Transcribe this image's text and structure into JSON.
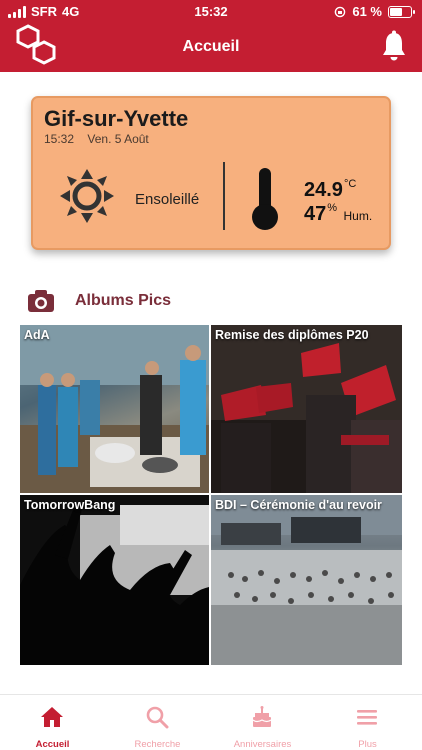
{
  "status_bar": {
    "carrier": "SFR",
    "network": "4G",
    "time": "15:32",
    "battery": "61 %",
    "battery_level": 0.61
  },
  "nav": {
    "title": "Accueil"
  },
  "weather": {
    "city": "Gif-sur-Yvette",
    "time": "15:32",
    "date": "Ven. 5 Août",
    "condition": "Ensoleillé",
    "temperature": "24.9",
    "temperature_unit": "°C",
    "humidity": "47",
    "humidity_unit": "%",
    "humidity_label": "Hum."
  },
  "albums": {
    "title": "Albums Pics",
    "items": [
      {
        "label": "AdA"
      },
      {
        "label": "Remise des diplômes P20"
      },
      {
        "label": "TomorrowBang"
      },
      {
        "label": "BDI – Cérémonie d'au revoir"
      }
    ]
  },
  "tabbar": {
    "items": [
      {
        "label": "Accueil",
        "icon": "home-icon",
        "active": true
      },
      {
        "label": "Recherche",
        "icon": "search-icon",
        "active": false
      },
      {
        "label": "Anniversaires",
        "icon": "cake-icon",
        "active": false
      },
      {
        "label": "Plus",
        "icon": "menu-icon",
        "active": false
      }
    ]
  },
  "colors": {
    "brand": "#c41e32",
    "weather_card": "#f7b07e",
    "album_title": "#7a2e3a",
    "tab_inactive": "#f0a0a8"
  }
}
